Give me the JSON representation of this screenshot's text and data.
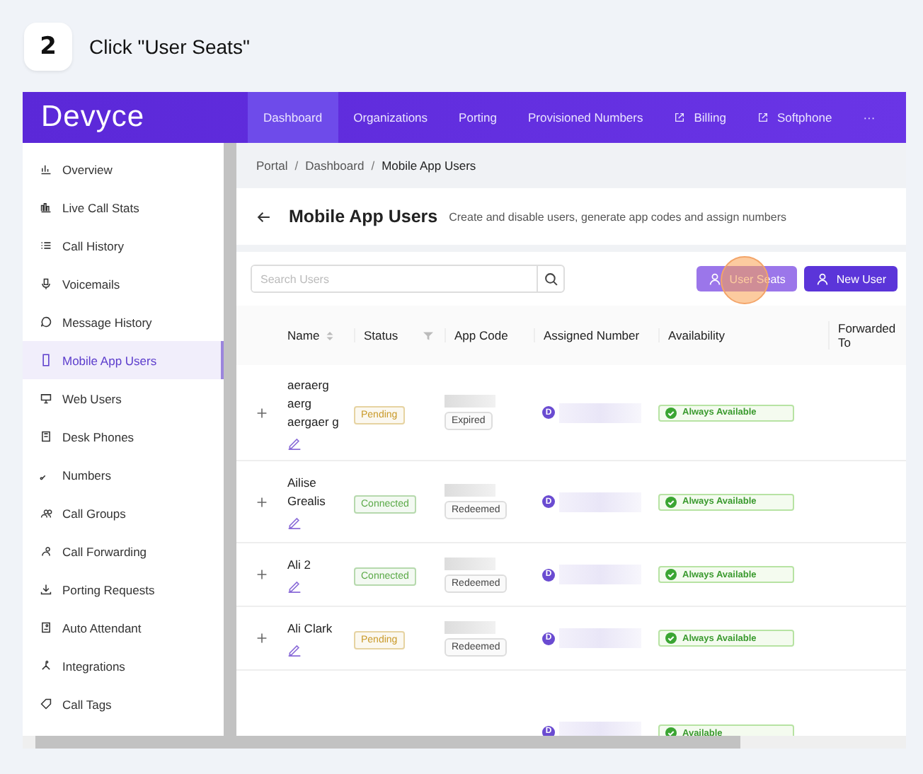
{
  "step": {
    "number": "2",
    "instruction": "Click \"User Seats\""
  },
  "brand": "Devyce",
  "nav": [
    {
      "label": "Dashboard",
      "selected": true,
      "external": false
    },
    {
      "label": "Organizations",
      "selected": false,
      "external": false
    },
    {
      "label": "Porting",
      "selected": false,
      "external": false
    },
    {
      "label": "Provisioned Numbers",
      "selected": false,
      "external": false
    },
    {
      "label": "Billing",
      "selected": false,
      "external": true
    },
    {
      "label": "Softphone",
      "selected": false,
      "external": true
    },
    {
      "label": "···",
      "selected": false,
      "external": false
    }
  ],
  "sidebar": {
    "items": [
      {
        "label": "Overview",
        "selected": false
      },
      {
        "label": "Live Call Stats",
        "selected": false
      },
      {
        "label": "Call History",
        "selected": false
      },
      {
        "label": "Voicemails",
        "selected": false
      },
      {
        "label": "Message History",
        "selected": false
      },
      {
        "label": "Mobile App Users",
        "selected": true
      },
      {
        "label": "Web Users",
        "selected": false
      },
      {
        "label": "Desk Phones",
        "selected": false
      },
      {
        "label": "Numbers",
        "selected": false
      },
      {
        "label": "Call Groups",
        "selected": false
      },
      {
        "label": "Call Forwarding",
        "selected": false
      },
      {
        "label": "Porting Requests",
        "selected": false
      },
      {
        "label": "Auto Attendant",
        "selected": false
      },
      {
        "label": "Integrations",
        "selected": false
      },
      {
        "label": "Call Tags",
        "selected": false
      }
    ]
  },
  "breadcrumb": [
    {
      "text": "Portal",
      "kind": "link"
    },
    {
      "text": "/",
      "kind": "separator"
    },
    {
      "text": "Dashboard",
      "kind": "link"
    },
    {
      "text": "/",
      "kind": "separator"
    },
    {
      "text": "Mobile App Users",
      "kind": "current"
    }
  ],
  "page": {
    "title": "Mobile App Users",
    "subtitle": "Create and disable users, generate app codes and assign numbers"
  },
  "search": {
    "placeholder": "Search Users"
  },
  "buttons": [
    {
      "label": "User Seats",
      "highlighted": true
    },
    {
      "label": "New User",
      "highlighted": false
    }
  ],
  "table": {
    "columns": [
      "Name",
      "Status",
      "App Code",
      "Assigned Number",
      "Availability",
      "Forwarded To"
    ],
    "rows": [
      {
        "name": "aeraerg aerg aergaer g",
        "status": {
          "label": "Pending",
          "color": "#c99a2a"
        },
        "code": "Expired",
        "avatar": "D",
        "availability": "Always Available"
      },
      {
        "name": "Ailise Grealis",
        "status": {
          "label": "Connected",
          "color": "#5aa947"
        },
        "code": "Redeemed",
        "avatar": "D",
        "availability": "Always Available"
      },
      {
        "name": "Ali 2",
        "status": {
          "label": "Connected",
          "color": "#5aa947"
        },
        "code": "Redeemed",
        "avatar": "D",
        "availability": "Always Available"
      },
      {
        "name": "Ali Clark",
        "status": {
          "label": "Pending",
          "color": "#c99a2a"
        },
        "code": "Redeemed",
        "avatar": "D",
        "availability": "Always Available"
      },
      {
        "avatar": "D",
        "availability": "Available"
      }
    ]
  }
}
